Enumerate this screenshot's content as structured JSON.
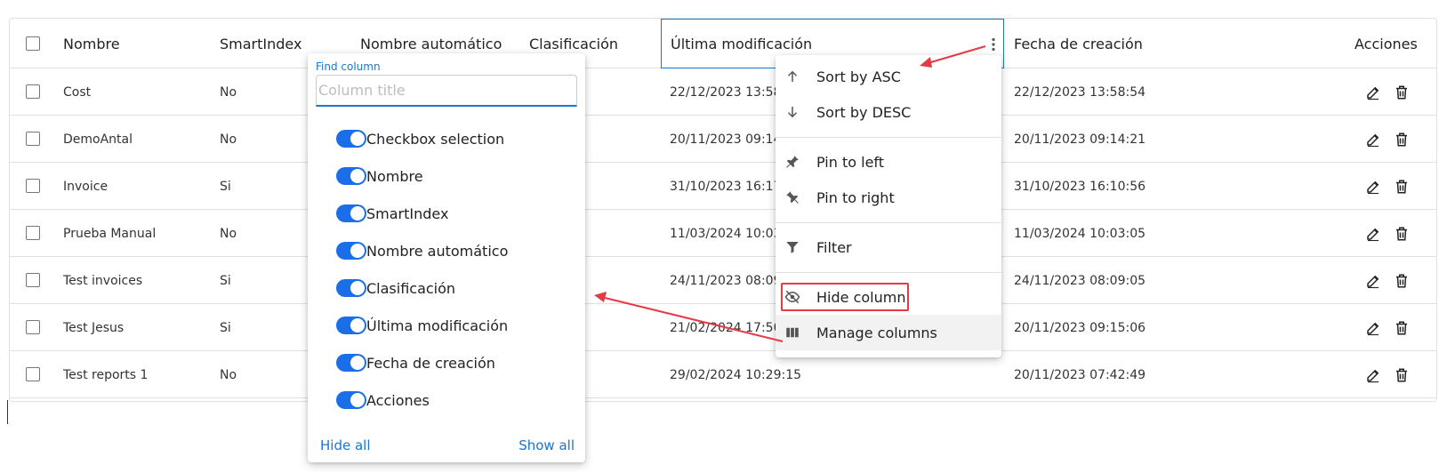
{
  "header": {
    "columns": [
      "Nombre",
      "SmartIndex",
      "Nombre automático",
      "Clasificación",
      "Última modificación",
      "Fecha de creación",
      "Acciones"
    ]
  },
  "rows": [
    {
      "nombre": "Cost",
      "smart": "No",
      "ultima": "22/12/2023 13:58:54",
      "fecha": "22/12/2023 13:58:54"
    },
    {
      "nombre": "DemoAntal",
      "smart": "No",
      "ultima": "20/11/2023 09:14:21",
      "fecha": "20/11/2023 09:14:21"
    },
    {
      "nombre": "Invoice",
      "smart": "Si",
      "ultima": "31/10/2023 16:17:18",
      "fecha": "31/10/2023 16:10:56"
    },
    {
      "nombre": "Prueba Manual",
      "smart": "No",
      "ultima": "11/03/2024 10:03:05",
      "fecha": "11/03/2024 10:03:05"
    },
    {
      "nombre": "Test invoices",
      "smart": "Si",
      "ultima": "24/11/2023 08:09:05",
      "fecha": "24/11/2023 08:09:05"
    },
    {
      "nombre": "Test Jesus",
      "smart": "Si",
      "ultima": "21/02/2024 17:50:12",
      "fecha": "20/11/2023 09:15:06"
    },
    {
      "nombre": "Test reports 1",
      "smart": "No",
      "ultima": "29/02/2024 10:29:15",
      "fecha": "20/11/2023 07:42:49"
    }
  ],
  "columns_panel": {
    "find_label": "Find column",
    "placeholder": "Column title",
    "toggles": [
      "Checkbox selection",
      "Nombre",
      "SmartIndex",
      "Nombre automático",
      "Clasificación",
      "Última modificación",
      "Fecha de creación",
      "Acciones"
    ],
    "hide_all": "Hide all",
    "show_all": "Show all"
  },
  "column_menu": {
    "sort_asc": "Sort by ASC",
    "sort_desc": "Sort by DESC",
    "pin_left": "Pin to left",
    "pin_right": "Pin to right",
    "filter": "Filter",
    "hide_column": "Hide column",
    "manage_columns": "Manage columns"
  },
  "icons": {
    "edit": "pencil-icon",
    "delete": "trash-icon",
    "kebab": "more-vert-icon",
    "sort_asc": "arrow-up-icon",
    "sort_desc": "arrow-down-icon",
    "pin": "pin-icon",
    "filter": "filter-icon",
    "hide": "eye-off-icon",
    "manage": "columns-icon"
  },
  "colors": {
    "accent": "#1976d2",
    "switch": "#1a6fe8",
    "annotation": "#e53945"
  }
}
